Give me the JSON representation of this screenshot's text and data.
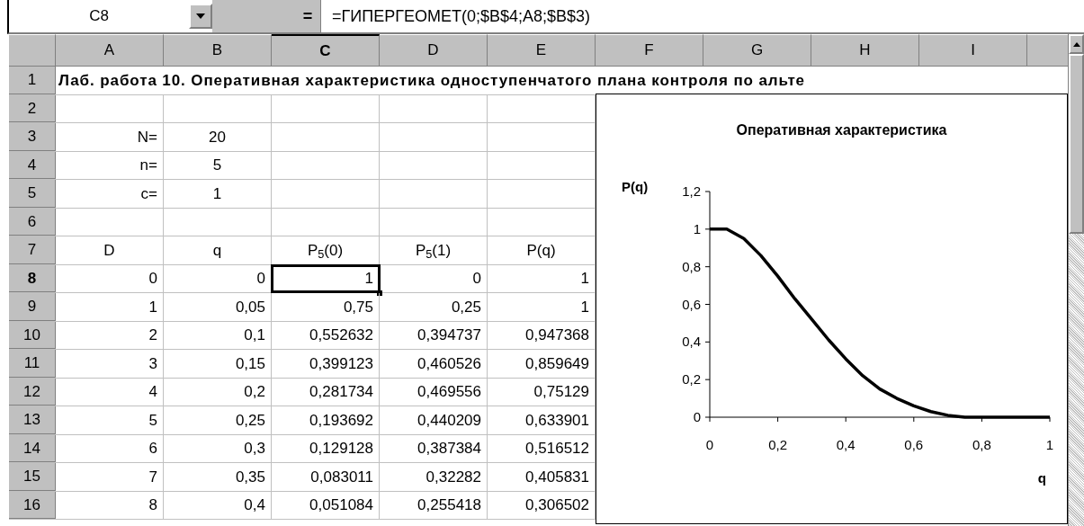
{
  "formula_bar": {
    "name_box": "C8",
    "equals": "=",
    "formula": "=ГИПЕРГЕОМЕТ(0;$B$4;A8;$B$3)"
  },
  "columns": [
    {
      "label": "A",
      "selected": false
    },
    {
      "label": "B",
      "selected": false
    },
    {
      "label": "C",
      "selected": true
    },
    {
      "label": "D",
      "selected": false
    },
    {
      "label": "E",
      "selected": false
    },
    {
      "label": "F",
      "selected": false
    },
    {
      "label": "G",
      "selected": false
    },
    {
      "label": "H",
      "selected": false
    },
    {
      "label": "I",
      "selected": false
    }
  ],
  "rows": [
    {
      "header": "1",
      "selected": false,
      "kind": "title",
      "title": "Лаб. работа 10. Оперативная характеристика одноступенчатого плана контроля по альте"
    },
    {
      "header": "2",
      "selected": false,
      "kind": "empty"
    },
    {
      "header": "3",
      "selected": false,
      "kind": "param",
      "cells": [
        {
          "text": "N=",
          "selected": false
        },
        {
          "text": "20",
          "selected": false
        }
      ]
    },
    {
      "header": "4",
      "selected": false,
      "kind": "param",
      "cells": [
        {
          "text": "n=",
          "selected": false
        },
        {
          "text": "5",
          "selected": false
        }
      ]
    },
    {
      "header": "5",
      "selected": false,
      "kind": "param",
      "cells": [
        {
          "text": "c=",
          "selected": false
        },
        {
          "text": "1",
          "selected": false
        }
      ]
    },
    {
      "header": "6",
      "selected": false,
      "kind": "empty"
    },
    {
      "header": "7",
      "selected": false,
      "kind": "heading",
      "cells": [
        {
          "text": "D",
          "selected": false
        },
        {
          "text": "q",
          "selected": false
        },
        {
          "text": "P$_{5}$(0)",
          "selected": false
        },
        {
          "text": "P$_{5}$(1)",
          "selected": false
        },
        {
          "text": "P(q)",
          "selected": false
        }
      ]
    },
    {
      "header": "8",
      "selected": true,
      "kind": "data",
      "cells": [
        {
          "text": "0",
          "selected": false
        },
        {
          "text": "0",
          "selected": false
        },
        {
          "text": "1",
          "selected": true
        },
        {
          "text": "0",
          "selected": false
        },
        {
          "text": "1",
          "selected": false
        }
      ]
    },
    {
      "header": "9",
      "selected": false,
      "kind": "data",
      "cells": [
        {
          "text": "1",
          "selected": false
        },
        {
          "text": "0,05",
          "selected": false
        },
        {
          "text": "0,75",
          "selected": false
        },
        {
          "text": "0,25",
          "selected": false
        },
        {
          "text": "1",
          "selected": false
        }
      ]
    },
    {
      "header": "10",
      "selected": false,
      "kind": "data",
      "cells": [
        {
          "text": "2",
          "selected": false
        },
        {
          "text": "0,1",
          "selected": false
        },
        {
          "text": "0,552632",
          "selected": false
        },
        {
          "text": "0,394737",
          "selected": false
        },
        {
          "text": "0,947368",
          "selected": false
        }
      ]
    },
    {
      "header": "11",
      "selected": false,
      "kind": "data",
      "cells": [
        {
          "text": "3",
          "selected": false
        },
        {
          "text": "0,15",
          "selected": false
        },
        {
          "text": "0,399123",
          "selected": false
        },
        {
          "text": "0,460526",
          "selected": false
        },
        {
          "text": "0,859649",
          "selected": false
        }
      ]
    },
    {
      "header": "12",
      "selected": false,
      "kind": "data",
      "cells": [
        {
          "text": "4",
          "selected": false
        },
        {
          "text": "0,2",
          "selected": false
        },
        {
          "text": "0,281734",
          "selected": false
        },
        {
          "text": "0,469556",
          "selected": false
        },
        {
          "text": "0,75129",
          "selected": false
        }
      ]
    },
    {
      "header": "13",
      "selected": false,
      "kind": "data",
      "cells": [
        {
          "text": "5",
          "selected": false
        },
        {
          "text": "0,25",
          "selected": false
        },
        {
          "text": "0,193692",
          "selected": false
        },
        {
          "text": "0,440209",
          "selected": false
        },
        {
          "text": "0,633901",
          "selected": false
        }
      ]
    },
    {
      "header": "14",
      "selected": false,
      "kind": "data",
      "cells": [
        {
          "text": "6",
          "selected": false
        },
        {
          "text": "0,3",
          "selected": false
        },
        {
          "text": "0,129128",
          "selected": false
        },
        {
          "text": "0,387384",
          "selected": false
        },
        {
          "text": "0,516512",
          "selected": false
        }
      ]
    },
    {
      "header": "15",
      "selected": false,
      "kind": "data",
      "cells": [
        {
          "text": "7",
          "selected": false
        },
        {
          "text": "0,35",
          "selected": false
        },
        {
          "text": "0,083011",
          "selected": false
        },
        {
          "text": "0,32282",
          "selected": false
        },
        {
          "text": "0,405831",
          "selected": false
        }
      ]
    },
    {
      "header": "16",
      "selected": false,
      "kind": "data",
      "cells": [
        {
          "text": "8",
          "selected": false
        },
        {
          "text": "0,4",
          "selected": false
        },
        {
          "text": "0,051084",
          "selected": false
        },
        {
          "text": "0,255418",
          "selected": false
        },
        {
          "text": "0,306502",
          "selected": false
        }
      ]
    }
  ],
  "chart": {
    "chart_data": {
      "type": "line",
      "title": "Оперативная характеристика",
      "xlabel": "q",
      "ylabel": "P(q)",
      "x": [
        0,
        0.05,
        0.1,
        0.15,
        0.2,
        0.25,
        0.3,
        0.35,
        0.4,
        0.45,
        0.5,
        0.55,
        0.6,
        0.65,
        0.7,
        0.75,
        0.8,
        0.85,
        0.9,
        0.95,
        1
      ],
      "series": [
        {
          "color": "#000000",
          "values": [
            1,
            1,
            0.95,
            0.86,
            0.75,
            0.63,
            0.52,
            0.41,
            0.31,
            0.22,
            0.15,
            0.1,
            0.06,
            0.03,
            0.01,
            0,
            0,
            0,
            0,
            0,
            0
          ]
        }
      ],
      "xlim": [
        0,
        1
      ],
      "ylim": [
        0,
        1.2
      ],
      "xticks": [
        {
          "value": 0,
          "label": "0"
        },
        {
          "value": 0.2,
          "label": "0,2"
        },
        {
          "value": 0.4,
          "label": "0,4"
        },
        {
          "value": 0.6,
          "label": "0,6"
        },
        {
          "value": 0.8,
          "label": "0,8"
        },
        {
          "value": 1,
          "label": "1"
        }
      ],
      "yticks": [
        {
          "value": 0,
          "label": "0"
        },
        {
          "value": 0.2,
          "label": "0,2"
        },
        {
          "value": 0.4,
          "label": "0,4"
        },
        {
          "value": 0.6,
          "label": "0,6"
        },
        {
          "value": 0.8,
          "label": "0,8"
        },
        {
          "value": 1,
          "label": "1"
        },
        {
          "value": 1.2,
          "label": "1,2"
        }
      ]
    }
  }
}
